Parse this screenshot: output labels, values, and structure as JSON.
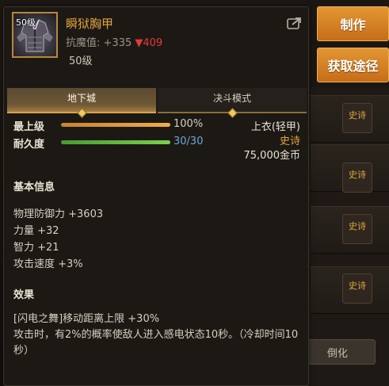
{
  "background": {
    "craft_button": "制作",
    "obtain_button": "获取途径",
    "grade_tags": [
      "史诗",
      "史诗",
      "史诗",
      "史诗"
    ],
    "bottom_button": "倒化"
  },
  "item": {
    "icon_level": "50级",
    "name": "瞬狱胸甲",
    "resist_label": "抗魔值:",
    "resist_value": "+335",
    "resist_diff": "▼409",
    "level": "50级",
    "share_icon": "share-icon"
  },
  "tabs": [
    {
      "label": "地下城",
      "active": true
    },
    {
      "label": "决斗模式",
      "active": false
    }
  ],
  "stats": {
    "quality_label": "最上级",
    "quality_value": "100%",
    "quality_fraction": 1.0,
    "durability_label": "耐久度",
    "durability_value": "30/30",
    "durability_fraction": 1.0
  },
  "info": {
    "slot": "上衣(轻甲)",
    "grade": "史诗",
    "price": "75,000金币"
  },
  "basic": {
    "title": "基本信息",
    "attributes": [
      "物理防御力 +3603",
      "力量 +32",
      "智力 +21",
      "攻击速度 +3%"
    ]
  },
  "effect": {
    "title": "效果",
    "line1": "[闪电之舞]移动距离上限 +30%",
    "line2": "攻击时，有2%的概率使敌人进入感电状态10秒。（冷却时间10秒）"
  },
  "colors": {
    "item_name": "#e4a33a",
    "grade": "#e4a33a",
    "resist_down": "#e23a3a",
    "durability_text": "#6fa7d8",
    "button_orange": "#d37f24"
  }
}
